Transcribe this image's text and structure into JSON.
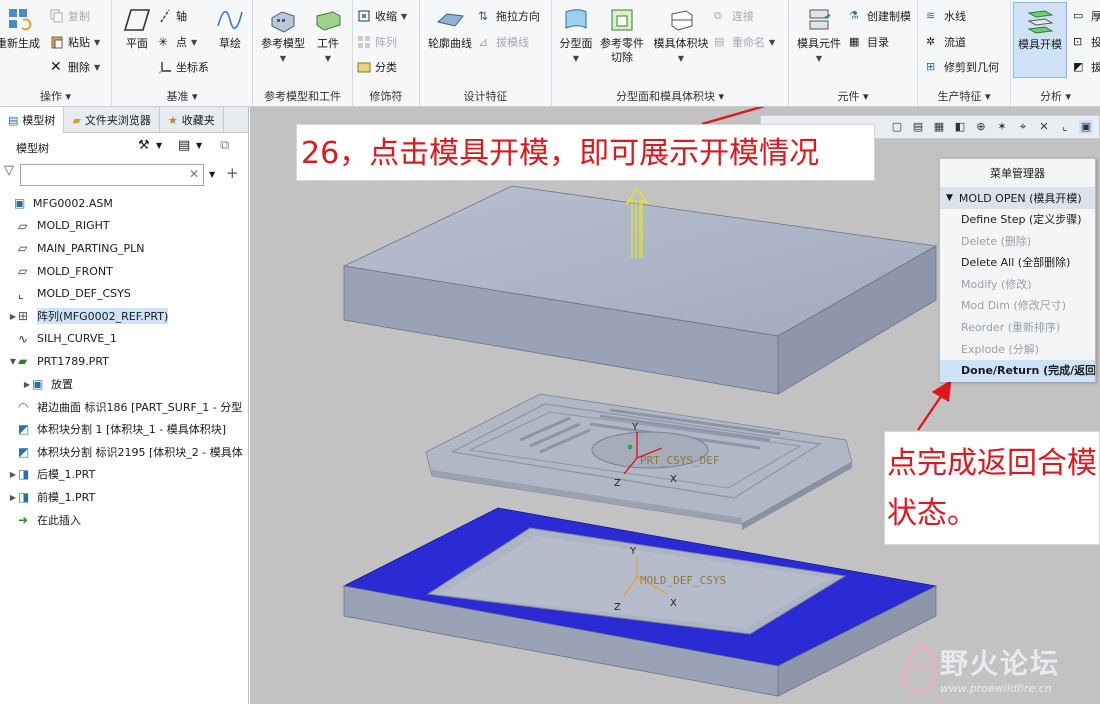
{
  "ribbon": {
    "groups": [
      {
        "label": "操作 ▾"
      },
      {
        "label": "基准 ▾"
      },
      {
        "label": "参考模型和工件"
      },
      {
        "label": "修饰符"
      },
      {
        "label": "设计特征"
      },
      {
        "label": "分型面和模具体积块 ▾"
      },
      {
        "label": "元件 ▾"
      },
      {
        "label": "生产特征 ▾"
      },
      {
        "label": "分析 ▾"
      }
    ],
    "ops": {
      "regen": "重新生成",
      "copy": "复制",
      "paste": "粘贴",
      "delete": "删除"
    },
    "datum": {
      "plane": "平面",
      "axis": "轴",
      "point": "点",
      "csys": "坐标系",
      "sketch": "草绘"
    },
    "refmodel": {
      "ref_model": "参考模型",
      "workpiece": "工件"
    },
    "mods": {
      "shrink": "收缩",
      "pattern": "阵列",
      "classify": "分类"
    },
    "design": {
      "silh": "轮廓曲线",
      "extrude_dir": "拖拉方向",
      "draft": "拔模线"
    },
    "parting": {
      "parting_surf": "分型面",
      "ref_cut": "参考零件切除",
      "mold_vol": "模具体积块",
      "connect": "连接",
      "rename": "重命名"
    },
    "components": {
      "mold_comp": "模具元件",
      "create_mold": "创建制模",
      "bom": "目录"
    },
    "production": {
      "waterline": "水线",
      "runner": "流道",
      "trim": "修剪到几何"
    },
    "analysis": {
      "mold_open": "模具开模",
      "thick": "厚",
      "proj": "投",
      "draft": "拔"
    }
  },
  "left_pane": {
    "tabs": [
      "模型树",
      "文件夹浏览器",
      "收藏夹"
    ],
    "tree_title": "模型树",
    "filter_placeholder": "",
    "items": [
      {
        "label": "MFG0002.ASM",
        "icon": "assembly-icon",
        "expand": "",
        "indent": 0
      },
      {
        "label": "MOLD_RIGHT",
        "icon": "datum-plane-icon",
        "expand": "",
        "indent": 1
      },
      {
        "label": "MAIN_PARTING_PLN",
        "icon": "datum-plane-icon",
        "expand": "",
        "indent": 1
      },
      {
        "label": "MOLD_FRONT",
        "icon": "datum-plane-icon",
        "expand": "",
        "indent": 1
      },
      {
        "label": "MOLD_DEF_CSYS",
        "icon": "csys-icon",
        "expand": "",
        "indent": 1
      },
      {
        "label": "阵列(MFG0002_REF.PRT)",
        "icon": "pattern-icon",
        "expand": "▶",
        "indent": 1,
        "selected": true
      },
      {
        "label": "SILH_CURVE_1",
        "icon": "curve-icon",
        "expand": "",
        "indent": 1
      },
      {
        "label": "PRT1789.PRT",
        "icon": "part-icon",
        "expand": "▼",
        "indent": 1
      },
      {
        "label": "放置",
        "icon": "placement-icon",
        "expand": "▶",
        "indent": 2
      },
      {
        "label": "裙边曲面 标识186 [PART_SURF_1 - 分型",
        "icon": "surface-icon",
        "expand": "",
        "indent": 1
      },
      {
        "label": "体积块分割 1 [体积块_1 - 模具体积块]",
        "icon": "volume-icon",
        "expand": "",
        "indent": 1
      },
      {
        "label": "体积块分割 标识2195 [体积块_2 - 模具体",
        "icon": "volume-icon",
        "expand": "",
        "indent": 1
      },
      {
        "label": "后模_1.PRT",
        "icon": "mold-part-icon",
        "expand": "▶",
        "indent": 1
      },
      {
        "label": "前模_1.PRT",
        "icon": "mold-part-icon",
        "expand": "▶",
        "indent": 1
      },
      {
        "label": "在此插入",
        "icon": "insert-arrow-icon",
        "expand": "",
        "indent": 1
      }
    ]
  },
  "viewport": {
    "annotation_top": "26，点击模具开模，即可展示开模情况",
    "annotation_right": "点完成返回合模状态。",
    "part_csys_label": "PRT_CSYS_DEF",
    "mold_csys_label": "MOLD_DEF_CSYS",
    "axis_labels": {
      "x": "X",
      "y": "Y",
      "z": "Z"
    }
  },
  "menu_manager": {
    "title": "菜单管理器",
    "section": "MOLD OPEN (模具开模)",
    "items": [
      {
        "label": "Define Step (定义步骤)",
        "enabled": true
      },
      {
        "label": "Delete (删除)",
        "enabled": false
      },
      {
        "label": "Delete All (全部删除)",
        "enabled": true
      },
      {
        "label": "Modify (修改)",
        "enabled": false
      },
      {
        "label": "Mod Dim (修改尺寸)",
        "enabled": false
      },
      {
        "label": "Reorder (重新排序)",
        "enabled": false
      },
      {
        "label": "Explode (分解)",
        "enabled": false
      },
      {
        "label": "Done/Return (完成/返回)",
        "enabled": true,
        "highlight": true
      }
    ]
  },
  "watermark": {
    "title": "野火论坛",
    "url": "www.proewildfire.cn"
  },
  "colors": {
    "annotation": "#e0181e",
    "parting_surface": "#2b2bd6",
    "plate": "#a7b0c2",
    "viewport_bg": "#c2c2c3"
  }
}
